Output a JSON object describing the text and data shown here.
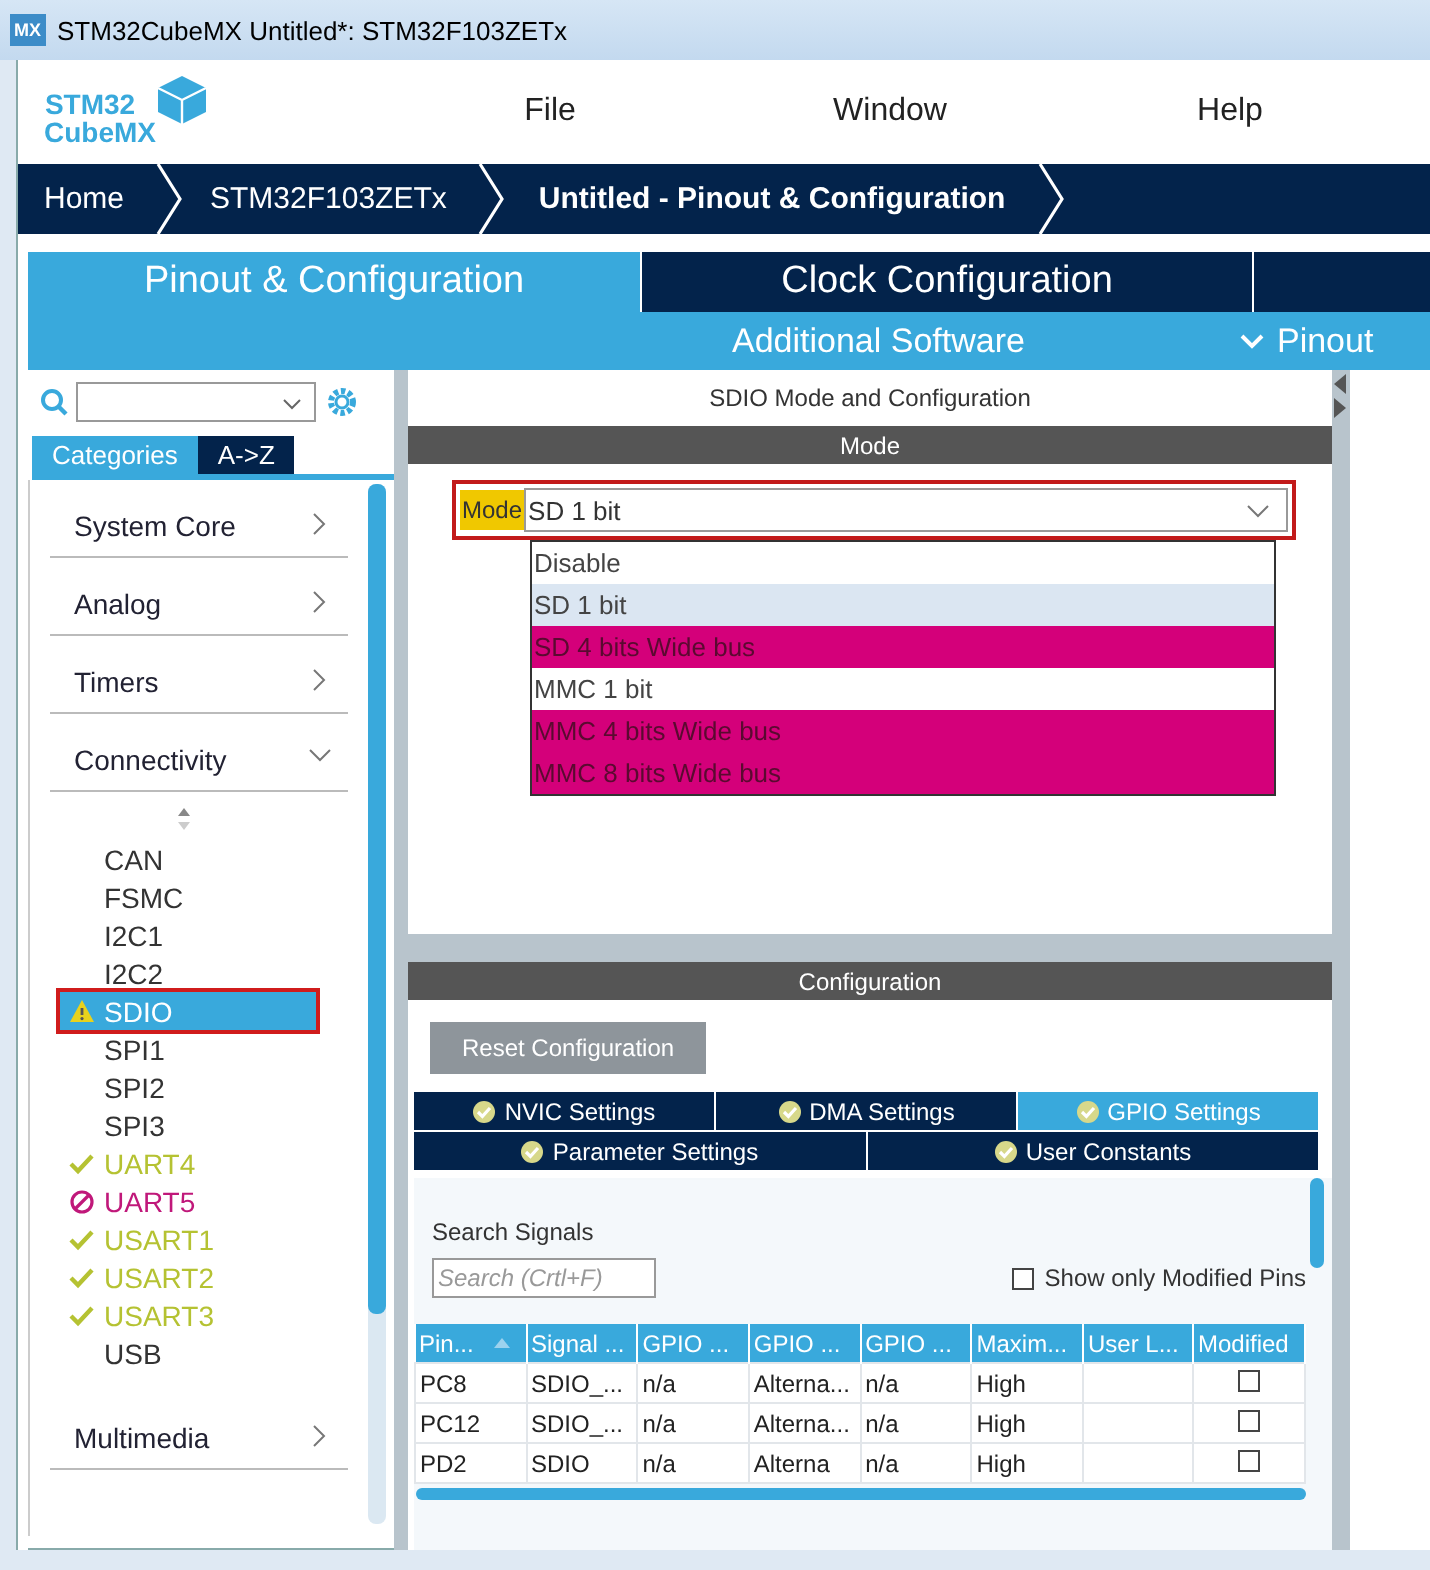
{
  "window": {
    "icon_text": "MX",
    "title": "STM32CubeMX Untitled*: STM32F103ZETx"
  },
  "logo": {
    "line1": "STM32",
    "line2": "CubeMX"
  },
  "menu": [
    "File",
    "Window",
    "Help"
  ],
  "breadcrumb": [
    {
      "label": "Home",
      "selected": false
    },
    {
      "label": "STM32F103ZETx",
      "selected": false
    },
    {
      "label": "Untitled - Pinout & Configuration",
      "selected": true
    }
  ],
  "main_tabs": [
    {
      "label": "Pinout & Configuration",
      "selected": true
    },
    {
      "label": "Clock Configuration",
      "selected": false
    }
  ],
  "sub_bar": {
    "additional_software": "Additional Software",
    "pinout": "Pinout"
  },
  "sidebar": {
    "category_tabs": [
      {
        "label": "Categories",
        "selected": true
      },
      {
        "label": "A->Z",
        "selected": false
      }
    ],
    "categories": [
      {
        "label": "System Core",
        "expanded": false
      },
      {
        "label": "Analog",
        "expanded": false
      },
      {
        "label": "Timers",
        "expanded": false
      },
      {
        "label": "Connectivity",
        "expanded": true,
        "children": [
          {
            "label": "CAN",
            "kind": "plain",
            "selected": false
          },
          {
            "label": "FSMC",
            "kind": "plain",
            "selected": false
          },
          {
            "label": "I2C1",
            "kind": "plain",
            "selected": false
          },
          {
            "label": "I2C2",
            "kind": "plain",
            "selected": false
          },
          {
            "label": "SDIO",
            "kind": "warning",
            "selected": true
          },
          {
            "label": "SPI1",
            "kind": "plain",
            "selected": false
          },
          {
            "label": "SPI2",
            "kind": "plain",
            "selected": false
          },
          {
            "label": "SPI3",
            "kind": "plain",
            "selected": false
          },
          {
            "label": "UART4",
            "kind": "ok",
            "selected": false
          },
          {
            "label": "UART5",
            "kind": "error",
            "selected": false
          },
          {
            "label": "USART1",
            "kind": "ok",
            "selected": false
          },
          {
            "label": "USART2",
            "kind": "ok",
            "selected": false
          },
          {
            "label": "USART3",
            "kind": "ok",
            "selected": false
          },
          {
            "label": "USB",
            "kind": "plain",
            "selected": false
          }
        ]
      },
      {
        "label": "Multimedia",
        "expanded": false
      }
    ]
  },
  "panel": {
    "title": "SDIO Mode and Configuration",
    "mode_header": "Mode",
    "mode_field": {
      "label": "Mode",
      "value": "SD 1 bit"
    },
    "mode_options": [
      {
        "label": "Disable",
        "selected": false,
        "conflict": false
      },
      {
        "label": "SD 1 bit",
        "selected": true,
        "conflict": false
      },
      {
        "label": "SD 4 bits Wide bus",
        "selected": false,
        "conflict": true
      },
      {
        "label": "MMC 1 bit",
        "selected": false,
        "conflict": false
      },
      {
        "label": "MMC 4 bits Wide bus",
        "selected": false,
        "conflict": true
      },
      {
        "label": "MMC 8 bits Wide bus",
        "selected": false,
        "conflict": true
      }
    ],
    "config_header": "Configuration",
    "reset_button": "Reset Configuration",
    "config_tab_rows": [
      [
        {
          "label": "NVIC Settings",
          "selected": false
        },
        {
          "label": "DMA Settings",
          "selected": false
        },
        {
          "label": "GPIO Settings",
          "selected": true
        }
      ],
      [
        {
          "label": "Parameter Settings",
          "selected": false
        },
        {
          "label": "User Constants",
          "selected": false
        }
      ]
    ],
    "search_label": "Search Signals",
    "search": {
      "placeholder": "Search (Crtl+F)"
    },
    "show_modified": {
      "label": "Show only Modified Pins",
      "checked": false
    },
    "table": {
      "columns": [
        {
          "label": "Pin...",
          "sorted": true
        },
        {
          "label": "Signal ...",
          "sorted": false
        },
        {
          "label": "GPIO ...",
          "sorted": false
        },
        {
          "label": "GPIO ...",
          "sorted": false
        },
        {
          "label": "GPIO ...",
          "sorted": false
        },
        {
          "label": "Maxim...",
          "sorted": false
        },
        {
          "label": "User L...",
          "sorted": false
        },
        {
          "label": "Modified",
          "sorted": false
        }
      ],
      "rows": [
        {
          "cells": [
            "PC8",
            "SDIO_...",
            "n/a",
            "Alterna...",
            "n/a",
            "High",
            ""
          ],
          "modified": false
        },
        {
          "cells": [
            "PC12",
            "SDIO_...",
            "n/a",
            "Alterna...",
            "n/a",
            "High",
            ""
          ],
          "modified": false
        },
        {
          "cells": [
            "PD2",
            "SDIO",
            "n/a",
            "Alterna",
            "n/a",
            "High",
            ""
          ],
          "modified": false
        }
      ]
    }
  }
}
